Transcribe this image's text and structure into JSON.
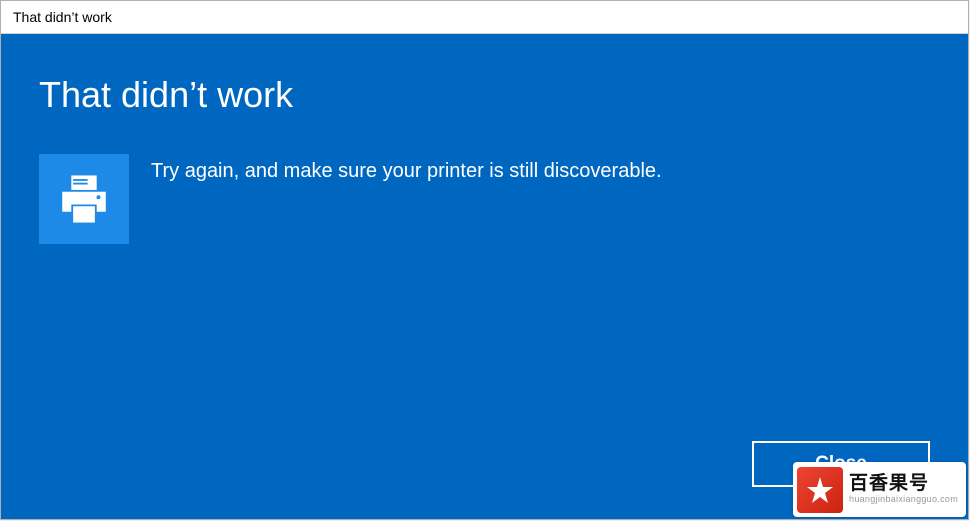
{
  "titlebar": {
    "title": "That didn’t work"
  },
  "dialog": {
    "heading": "That didn’t work",
    "message": "Try again, and make sure your printer is still discoverable.",
    "icon": "printer-icon",
    "close_label": "Close"
  },
  "watermark": {
    "main": "百香果号",
    "sub": "huangjinbaixiangguo.com"
  },
  "colors": {
    "accent": "#0067c0",
    "icon_bg": "#1e8ae7"
  }
}
